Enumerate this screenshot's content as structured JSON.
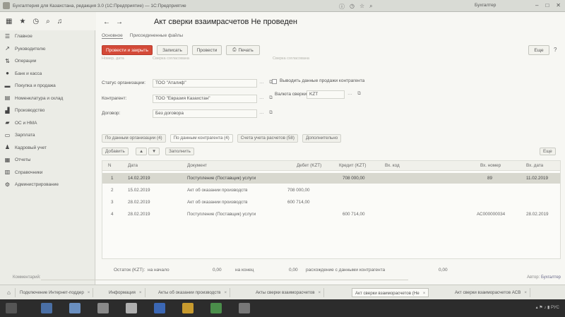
{
  "window": {
    "title": "Бухгалтерия для Казахстана, редакция 3.0 (1С:Предприятие) — 1С:Предприятие",
    "user": "Бухгалтер"
  },
  "sidebar": {
    "items": [
      {
        "label": "Главное",
        "icon": "home-icon"
      },
      {
        "label": "Руководителю",
        "icon": "chart-icon"
      },
      {
        "label": "Операции",
        "icon": "operations-icon"
      },
      {
        "label": "Банк и касса",
        "icon": "bank-icon"
      },
      {
        "label": "Покупка и продажа",
        "icon": "cart-icon"
      },
      {
        "label": "Номенклатура и склад",
        "icon": "warehouse-icon"
      },
      {
        "label": "Производство",
        "icon": "factory-icon"
      },
      {
        "label": "ОС и НМА",
        "icon": "assets-icon"
      },
      {
        "label": "Зарплата",
        "icon": "salary-icon"
      },
      {
        "label": "Кадровый учет",
        "icon": "people-icon"
      },
      {
        "label": "Отчеты",
        "icon": "reports-icon"
      },
      {
        "label": "Справочники",
        "icon": "books-icon"
      },
      {
        "label": "Администрирование",
        "icon": "gear-icon"
      }
    ]
  },
  "document": {
    "title": "Акт сверки взаимрасчетов  Не проведен",
    "subtabs": [
      "Основное",
      "Присоединенные файлы"
    ]
  },
  "commands": {
    "post_close": "Провести и закрыть",
    "save": "Записать",
    "post": "Провести",
    "print": "Печать",
    "more": "Еще"
  },
  "ghost_labels": {
    "left": "Номер, дата",
    "mid": "Сверка согласована",
    "right": "Сверка согласована"
  },
  "form": {
    "status_label": "Статус организации:",
    "status_value": "ТОО \"Аталиф\"",
    "counterparty_label": "Контрагент:",
    "counterparty_value": "ТОО \"Евразия Казахстан\"",
    "contract_label": "Договор:",
    "contract_value": "Без договора",
    "checkbox_label": "Выводить данные продажи контрагента",
    "currency_label": "Валюта сверки:",
    "currency_value": "KZT"
  },
  "data_tabs": [
    "По данным организации (4)",
    "По данным контрагента (4)",
    "Счета учета расчетов (58)",
    "Дополнительно"
  ],
  "table_tools": {
    "add": "Добавить",
    "fill": "Заполнить",
    "more": "Еще"
  },
  "table": {
    "headers": [
      "N",
      "Дата",
      "Документ",
      "Дебет (KZT)",
      "Кредит (KZT)",
      "Вх. код",
      "Вх. номер",
      "Вх. дата"
    ],
    "rows": [
      {
        "n": "1",
        "date": "14.02.2019",
        "doc": "Поступление (Поставщик) услуги",
        "debit": "",
        "credit": "708 000,00",
        "code": "",
        "num": "89",
        "indate": "11.02.2019"
      },
      {
        "n": "2",
        "date": "15.02.2019",
        "doc": "Акт об оказании производств",
        "debit": "708 000,00",
        "credit": "",
        "code": "",
        "num": "",
        "indate": ""
      },
      {
        "n": "3",
        "date": "28.02.2019",
        "doc": "Акт об оказании производств",
        "debit": "600 714,00",
        "credit": "",
        "code": "",
        "num": "",
        "indate": ""
      },
      {
        "n": "4",
        "date": "28.02.2019",
        "doc": "Поступление (Поставщик) услуги",
        "debit": "",
        "credit": "600 714,00",
        "code": "",
        "num": "АС000000034",
        "indate": "28.02.2019"
      }
    ]
  },
  "totals": {
    "label": "Остаток (KZT):",
    "start_label": "на начало",
    "start_value": "0,00",
    "end_label": "на конец",
    "end_value": "0,00",
    "diff_label": "расхождение с данными контрагента",
    "diff_value": "0,00"
  },
  "footer": {
    "comment": "Комментарий:",
    "author_label": "Автор:",
    "author_value": "Бухгалтер"
  },
  "open_tabs": [
    "Подключение Интернет-поддер",
    "Информация",
    "Акты об оказании производств",
    "Акты сверки взаиморасчетов",
    "Акт сверки взаиморасчетов (Не",
    "Акт сверки взаиморасчетов АСВ"
  ],
  "colors": {
    "primary_button": "#d44a38",
    "selected_row": "#d8d8cf"
  }
}
